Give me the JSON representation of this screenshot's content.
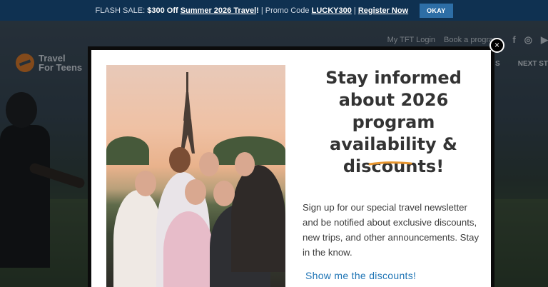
{
  "flash_bar": {
    "prefix": "FLASH SALE:",
    "amount": "$300 Off",
    "link": "Summer 2026 Travel",
    "bang": "!",
    "promo_label": "| Promo Code",
    "promo_code": "LUCKY300",
    "sep": "|",
    "register": "Register Now",
    "okay_button": "OKAY"
  },
  "site": {
    "logo_line1": "Travel",
    "logo_line2": "For Teens",
    "top_links": [
      "My TFT Login",
      "Book a program"
    ],
    "social_icons": [
      "facebook-icon",
      "instagram-icon",
      "youtube-icon"
    ],
    "nav_partial": "S",
    "nav_next": "NEXT ST"
  },
  "modal": {
    "heading": "Stay informed about 2026 program availability & discounts!",
    "description": "Sign up for our special travel newsletter and be notified about exclusive discounts, new trips, and other announcements. Stay in the know.",
    "cta": "Show me the discounts!",
    "close": "×",
    "accent_color": "#e8962f",
    "link_color": "#1e74b5"
  }
}
